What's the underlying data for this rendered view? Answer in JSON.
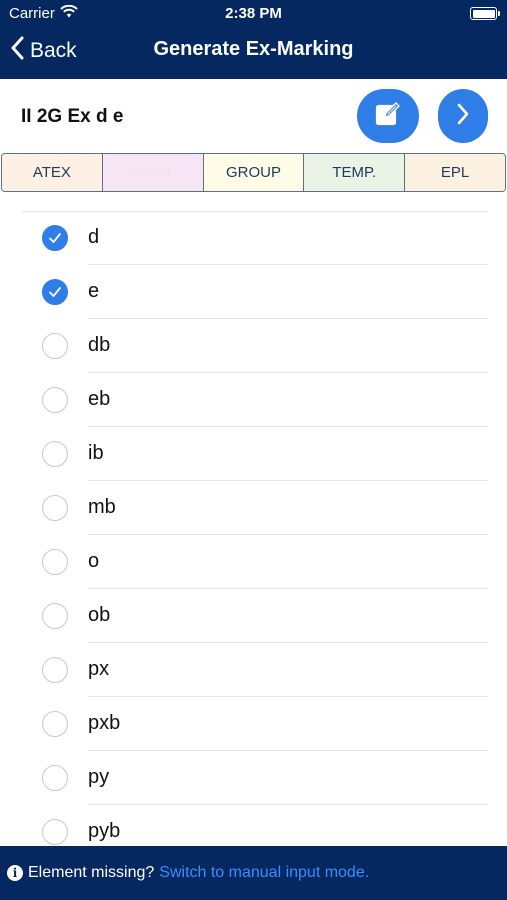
{
  "status": {
    "carrier": "Carrier",
    "time": "2:38 PM"
  },
  "nav": {
    "back_label": "Back",
    "title": "Generate Ex-Marking"
  },
  "marking": {
    "text": "II 2G Ex d e"
  },
  "tabs": [
    {
      "label": "ATEX",
      "bg": "#fcf1e4",
      "color": "#1d3a5a"
    },
    {
      "label": "PROT",
      "bg": "#f6e6f3",
      "color": "#efe3ee"
    },
    {
      "label": "GROUP",
      "bg": "#fefbe7",
      "color": "#1d3a5a"
    },
    {
      "label": "TEMP.",
      "bg": "#ebf3e6",
      "color": "#1d3a5a"
    },
    {
      "label": "EPL",
      "bg": "#fcf0e0",
      "color": "#1d3a5a"
    }
  ],
  "items": [
    {
      "label": "d",
      "checked": true
    },
    {
      "label": "e",
      "checked": true
    },
    {
      "label": "db",
      "checked": false
    },
    {
      "label": "eb",
      "checked": false
    },
    {
      "label": "ib",
      "checked": false
    },
    {
      "label": "mb",
      "checked": false
    },
    {
      "label": "o",
      "checked": false
    },
    {
      "label": "ob",
      "checked": false
    },
    {
      "label": "px",
      "checked": false
    },
    {
      "label": "pxb",
      "checked": false
    },
    {
      "label": "py",
      "checked": false
    },
    {
      "label": "pyb",
      "checked": false
    }
  ],
  "footer": {
    "text": "Element missing?",
    "link": "Switch to manual input mode."
  },
  "colors": {
    "header": "#04285f",
    "accent": "#2f7de6",
    "link": "#3d8bff"
  }
}
